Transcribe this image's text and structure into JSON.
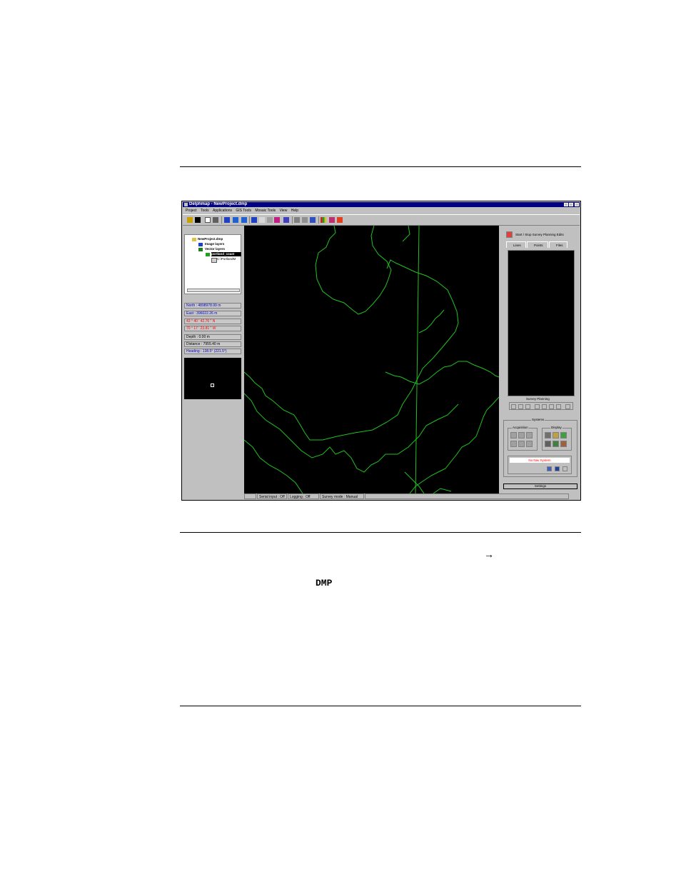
{
  "document": {
    "arrow": "→",
    "code_word": "DMP"
  },
  "window": {
    "title": "Delphmap - NewProject.dmp",
    "menus": [
      "Project",
      "Tools",
      "Applications",
      "GIS Tools",
      "Mosaic Tools",
      "View",
      "Help"
    ]
  },
  "tree": {
    "root": "NewProject.dmp",
    "image_layers": "Image layers",
    "vector_layers": "Vector layers",
    "layer": "portland_coast",
    "file": "C:\\PortlandM"
  },
  "readouts": {
    "north": "North : 4898978.99 m",
    "east": "East : 396022.26 m",
    "lat": "43 ° 40 ' 42.76 \" N",
    "lon": "70 ° 17 ' 23.81 \" W",
    "depth": "Depth : 0.00 m",
    "distance": "Distance : 7955.40 m",
    "heading": "Heading : 138.5° (221.5°)"
  },
  "colors": {
    "readout_blue": "#0000c0",
    "readout_red": "#ff0000",
    "coastline": "#22c022",
    "map_bg": "#000000",
    "title_bar": "#000080"
  },
  "right_panel": {
    "start_stop": "Start / Stop Survey Planning Edits",
    "tabs": [
      "Lines",
      "Points",
      "Files"
    ],
    "survey_planning": "Survey Planning",
    "systems": "Systems",
    "acquisition": "Acquisition",
    "display": "Display",
    "nav_status": "No Nav System",
    "settings": "Settings"
  },
  "status": {
    "serial": "Serial input : Off",
    "logging": "Logging : Off",
    "survey_mode": "Survey mode : Manual"
  }
}
